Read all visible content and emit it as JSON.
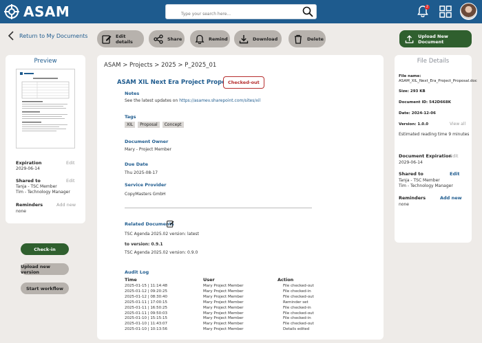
{
  "app": {
    "name": "ASAM"
  },
  "search": {
    "placeholder": "Type your search here..."
  },
  "notifications": {
    "count": "2"
  },
  "nav": {
    "back_label": "Return to My Documents"
  },
  "toolbar": {
    "edit_details": "Edit details",
    "share": "Share",
    "remind": "Remind",
    "download": "Download",
    "delete": "Delete",
    "upload_new": "Upload New Document"
  },
  "preview": {
    "title": "Preview",
    "expiration_label": "Expiration",
    "expiration_value": "2029-06-14",
    "shared_label": "Shared to",
    "shared_values": [
      "Tanja - TSC Member",
      "Tim - Technology Manager"
    ],
    "reminders_label": "Reminders",
    "reminders_value": "none",
    "edit": "Edit",
    "add_new": "Add new"
  },
  "actions": {
    "check_in": "Check-in",
    "upload_version": "Upload new version",
    "start_workflow": "Start workflow"
  },
  "breadcrumb": "ASAM > Projects > 2025 > P_2025_01",
  "document": {
    "title": "ASAM XIL Next Era Project Proposal",
    "status": "Checked-out",
    "notes_label": "Notes",
    "notes_text": "See the latest updates on",
    "notes_link": "https://asamev.sharepoint.com/sites/xil",
    "tags_label": "Tags",
    "tags": [
      "XIL",
      "Proposal",
      "Concept"
    ],
    "owner_label": "Document Owner",
    "owner_value": "Mary - Project Member",
    "due_label": "Due Date",
    "due_value": "Thu 2025-08-17",
    "provider_label": "Service Provider",
    "provider_value": "CopyMasters GmbH",
    "related_label": "Related Documents",
    "related_1": "TSC Agenda 2025.02   version: latest",
    "related_to_version": "to version: 0.9.1",
    "related_2": "TSC Agenda 2025.02   version: 0.9.0",
    "audit_label": "Audit Log",
    "audit_headers": [
      "Time",
      "User",
      "Action"
    ],
    "audit_rows": [
      [
        "2025-01-15 | 11:14:48",
        "Mary Project Member",
        "File checked-out"
      ],
      [
        "2025-01-12 | 09:20:25",
        "Mary Project Member",
        "File checked-in"
      ],
      [
        "2025-01-12 | 08:30:40",
        "Mary Project Member",
        "File checked-out"
      ],
      [
        "2025-01-11 | 17:00:15",
        "Mary Project Member",
        "Reminder set"
      ],
      [
        "2025-01-11 | 16:50:25",
        "Mary Project Member",
        "File checked-in"
      ],
      [
        "2025-01-11 | 09:50:03",
        "Mary Project Member",
        "File checked-out"
      ],
      [
        "2025-01-10 | 15:15:15",
        "Mary Project Member",
        "File checked-in"
      ],
      [
        "2025-01-10 | 11:43:07",
        "Mary Project Member",
        "File checked-out"
      ],
      [
        "2025-01-10 | 10:13:56",
        "Mary Project Member",
        "Details edited"
      ]
    ]
  },
  "file_details": {
    "title": "File Details",
    "file_name_label": "File name:",
    "file_name": "ASAM_XIL_Next_Era_Project_Proposal.docx",
    "size": "Size: 293 KB",
    "doc_id": "Document ID: 542D668K",
    "date": "Date: 2024-12-06",
    "version": "Version: 1.0.0",
    "view_all": "View all",
    "reading_time": "Estimated reading time 9 minutes",
    "expiration_label": "Document Expiration",
    "expiration_value": "2029-06-14",
    "shared_label": "Shared to",
    "shared_values": [
      "Tanja - TSC Member",
      "Tim - Technology Manager"
    ],
    "reminders_label": "Reminders",
    "reminders_value": "none",
    "edit": "Edit",
    "add_new": "Add new"
  },
  "colors": {
    "brand": "#1e5b8e",
    "primary_button": "#2f5f2e",
    "status": "#b52c2c"
  }
}
